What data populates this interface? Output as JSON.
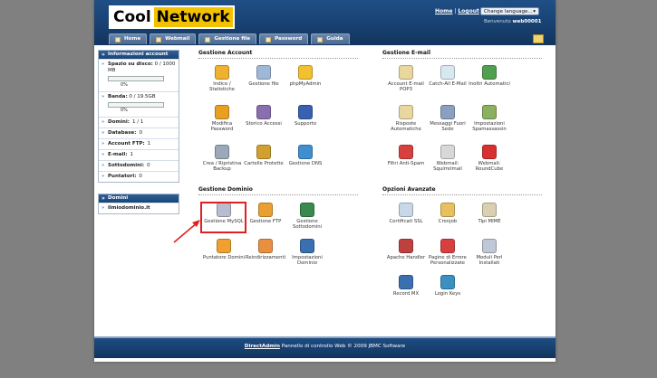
{
  "header": {
    "logo_part1": "Cool",
    "logo_part2": "Network",
    "home_link": "Home",
    "logout_link": "Logout",
    "separator": "|",
    "language_select": "Change language...",
    "welcome_prefix": "Benvenuto",
    "username": "web00001"
  },
  "tabs": [
    {
      "label": "Home",
      "icon": "home-icon"
    },
    {
      "label": "Webmail",
      "icon": "mail-icon"
    },
    {
      "label": "Gestione file",
      "icon": "folder-icon"
    },
    {
      "label": "Password",
      "icon": "key-icon"
    },
    {
      "label": "Guida",
      "icon": "help-icon"
    }
  ],
  "sidebar": {
    "account_title": "Informazioni account",
    "disk_label": "Spazio su disco:",
    "disk_value": "0 / 1000 MB",
    "disk_pct": "0%",
    "disk_fraction": 0,
    "bandwidth_label": "Banda:",
    "bandwidth_value": "0 / 19.5GB",
    "bandwidth_pct": "0%",
    "bandwidth_fraction": 0,
    "stats": [
      {
        "label": "Domini:",
        "value": "1 / 1"
      },
      {
        "label": "Database:",
        "value": "0"
      },
      {
        "label": "Account FTP:",
        "value": "1"
      },
      {
        "label": "E-mail:",
        "value": "1"
      },
      {
        "label": "Sottodomini:",
        "value": "0"
      },
      {
        "label": "Puntatori:",
        "value": "0"
      }
    ],
    "domains_title": "Domini",
    "domain": "ilmiodominio.it"
  },
  "gestione_account": {
    "title": "Gestione Account",
    "items": [
      {
        "label": "Indice / Statistiche",
        "icon": "statistics-icon",
        "color": "#f0b030"
      },
      {
        "label": "Gestione file",
        "icon": "file-manager-icon",
        "color": "#9fb8d8"
      },
      {
        "label": "phpMyAdmin",
        "icon": "phpmyadmin-icon",
        "color": "#f3c030"
      },
      {
        "label": "Modifica Password",
        "icon": "lock-icon",
        "color": "#e8a020"
      },
      {
        "label": "Storico Accessi",
        "icon": "log-icon",
        "color": "#8a6fb0"
      },
      {
        "label": "Supporto",
        "icon": "support-icon",
        "color": "#3a60b0"
      },
      {
        "label": "Crea / Ripristina Backup",
        "icon": "backup-icon",
        "color": "#9aa8b8"
      },
      {
        "label": "Cartelle Protette",
        "icon": "protected-folder-icon",
        "color": "#d0a030"
      },
      {
        "label": "Gestione DNS",
        "icon": "dns-icon",
        "color": "#3f8fd0"
      }
    ]
  },
  "gestione_email": {
    "title": "Gestione E-mail",
    "items": [
      {
        "label": "Account E-mail POP3",
        "icon": "email-account-icon",
        "color": "#e8d8a0"
      },
      {
        "label": "Catch-All E-Mail",
        "icon": "catch-all-icon",
        "color": "#d8e8f0"
      },
      {
        "label": "Inoltri Automatici",
        "icon": "forward-icon",
        "color": "#50a050"
      },
      {
        "label": "Risposte Automatiche",
        "icon": "autoresponder-icon",
        "color": "#e8d8a0"
      },
      {
        "label": "Messaggi Fuori Sede",
        "icon": "vacation-icon",
        "color": "#8aa0c0"
      },
      {
        "label": "Impostazioni Spamassassin",
        "icon": "spamassassin-icon",
        "color": "#8ab060"
      },
      {
        "label": "Filtri Anti-Spam",
        "icon": "spam-filter-icon",
        "color": "#d84040"
      },
      {
        "label": "Webmail: Squirrelmail",
        "icon": "squirrelmail-icon",
        "color": "#d8d8d8"
      },
      {
        "label": "Webmail: RoundCube",
        "icon": "roundcube-icon",
        "color": "#d83030"
      }
    ]
  },
  "gestione_dominio": {
    "title": "Gestione Dominio",
    "items": [
      {
        "label": "Gestione MySQL",
        "icon": "database-icon",
        "color": "#b8bcd0"
      },
      {
        "label": "Gestione FTP",
        "icon": "ftp-icon",
        "color": "#e8a030"
      },
      {
        "label": "Gestione Sottodomini",
        "icon": "subdomain-icon",
        "color": "#3a8a50"
      },
      {
        "label": "Puntatore Domini",
        "icon": "domain-pointer-icon",
        "color": "#f0a030"
      },
      {
        "label": "Reindirizzamenti",
        "icon": "redirect-icon",
        "color": "#e89040"
      },
      {
        "label": "Impostazioni Dominio",
        "icon": "domain-settings-icon",
        "color": "#3a70b0"
      }
    ]
  },
  "opzioni_avanzate": {
    "title": "Opzioni Avanzate",
    "items": [
      {
        "label": "Certificati SSL",
        "icon": "ssl-icon",
        "color": "#c8d8e8"
      },
      {
        "label": "Cronjob",
        "icon": "cronjob-icon",
        "color": "#e8c060"
      },
      {
        "label": "Tipi MIME",
        "icon": "mime-icon",
        "color": "#d8d0b0"
      },
      {
        "label": "Apache Handler",
        "icon": "apache-icon",
        "color": "#c04040"
      },
      {
        "label": "Pagine di Errore Personalizzate",
        "icon": "error-page-icon",
        "color": "#d84040"
      },
      {
        "label": "Moduli Perl Installati",
        "icon": "perl-icon",
        "color": "#c0c8d8"
      },
      {
        "label": "Record MX",
        "icon": "mx-record-icon",
        "color": "#3a70b0"
      },
      {
        "label": "Login Keys",
        "icon": "login-keys-icon",
        "color": "#3a90c0"
      }
    ]
  },
  "footer": {
    "link": "DirectAdmin",
    "text": "Pannello di controllo Web © 2009 JBMC Software"
  }
}
